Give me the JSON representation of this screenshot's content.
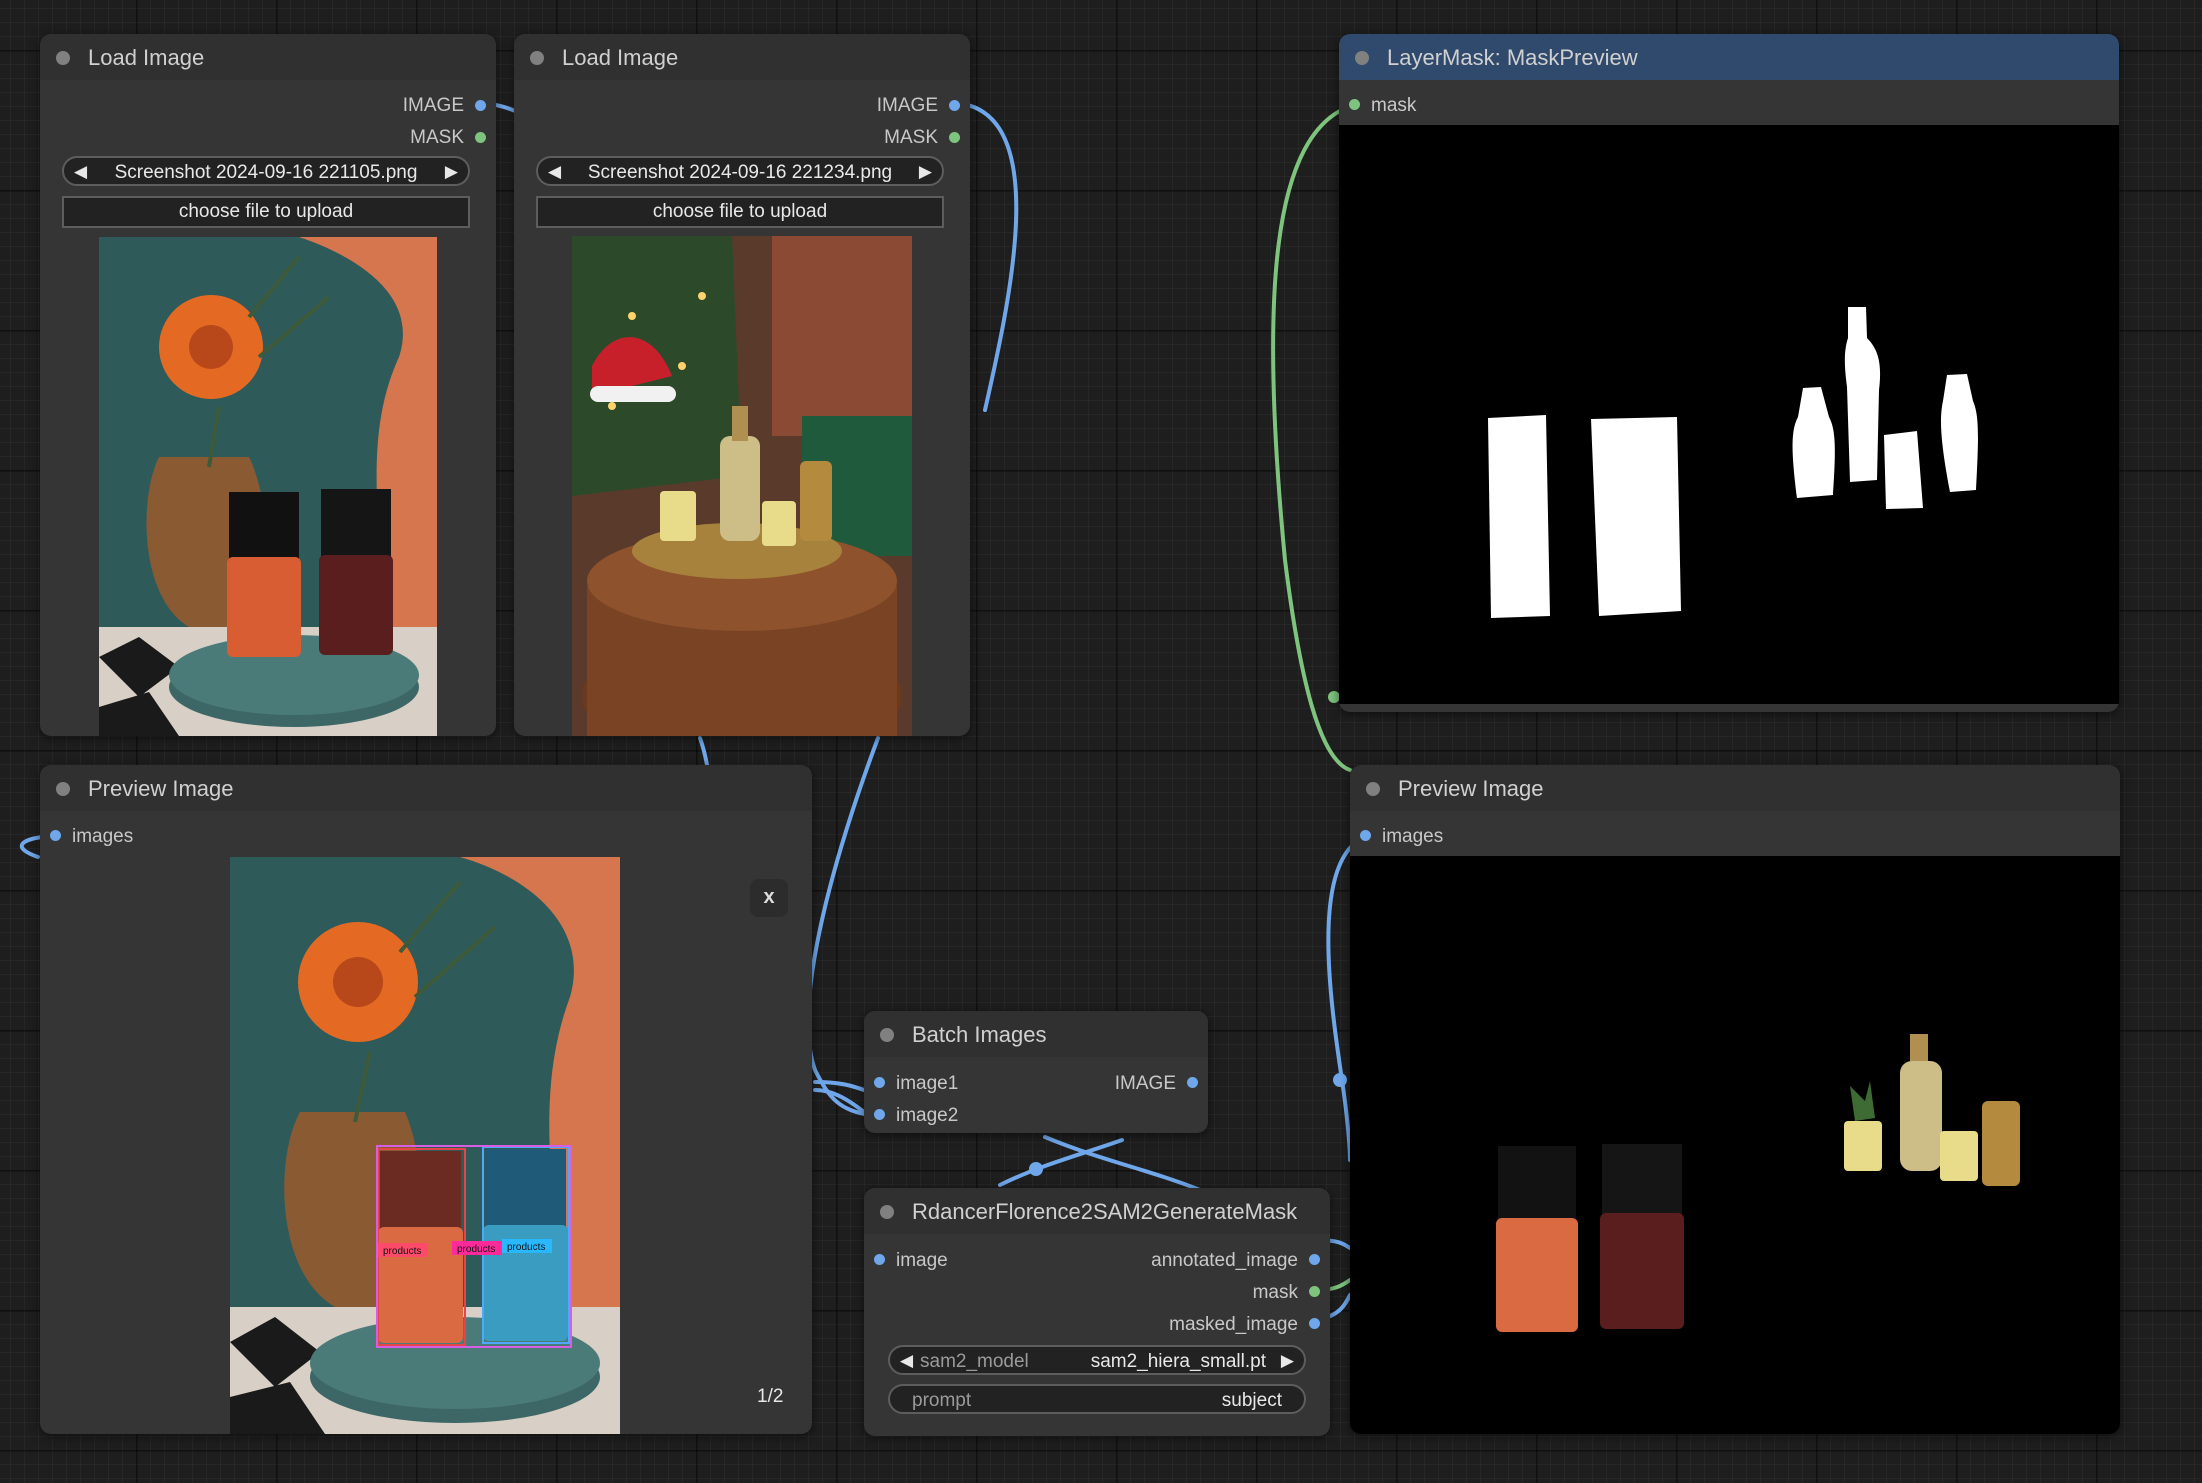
{
  "colors": {
    "canvas": "#1e1e1e",
    "node": "#353535",
    "header": "#303030",
    "header_active": "#2f4a6c",
    "wire_image": "#6fa7ea",
    "wire_mask": "#7ec47e"
  },
  "load1": {
    "title": "Load Image",
    "out_image": "IMAGE",
    "out_mask": "MASK",
    "file": "Screenshot 2024-09-16 221105.png",
    "upload": "choose file to upload"
  },
  "load2": {
    "title": "Load Image",
    "out_image": "IMAGE",
    "out_mask": "MASK",
    "file": "Screenshot 2024-09-16 221234.png",
    "upload": "choose file to upload"
  },
  "maskpreview": {
    "title": "LayerMask: MaskPreview",
    "in_mask": "mask"
  },
  "preview1": {
    "title": "Preview Image",
    "in_images": "images",
    "close": "x",
    "counter": "1/2",
    "box_label": "products"
  },
  "preview2": {
    "title": "Preview Image",
    "in_images": "images"
  },
  "batch": {
    "title": "Batch Images",
    "in1": "image1",
    "in2": "image2",
    "out": "IMAGE"
  },
  "florence": {
    "title": "RdancerFlorence2SAM2GenerateMask",
    "in_image": "image",
    "out_annotated": "annotated_image",
    "out_mask": "mask",
    "out_masked": "masked_image",
    "model_label": "sam2_model",
    "model_value": "sam2_hiera_small.pt",
    "prompt_label": "prompt",
    "prompt_value": "subject"
  },
  "icons": {
    "left": "triangle-left-icon",
    "right": "triangle-right-icon"
  }
}
